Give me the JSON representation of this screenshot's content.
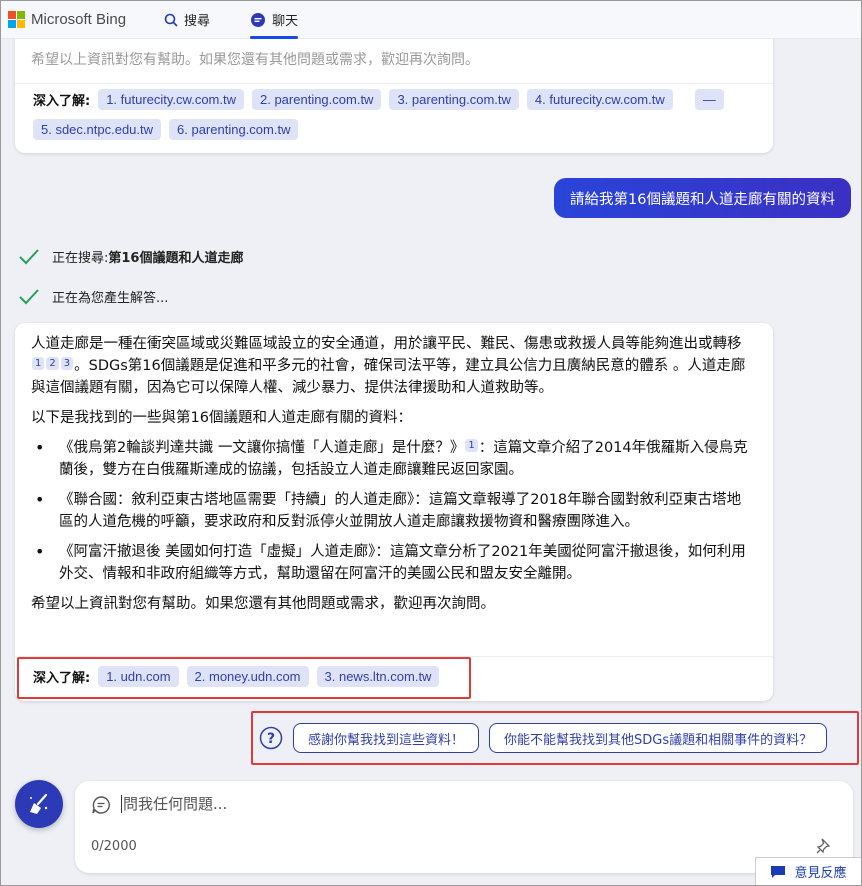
{
  "header": {
    "brand": "Microsoft Bing",
    "tabs": [
      {
        "label": "搜尋",
        "icon": "search-icon"
      },
      {
        "label": "聊天",
        "icon": "chat-icon",
        "active": true
      }
    ],
    "logo_colors": [
      "#f25022",
      "#7fba00",
      "#00a4ef",
      "#ffb900"
    ]
  },
  "previous_answer": {
    "closing_text": "希望以上資訊對您有幫助。如果您還有其他問題或需求，歡迎再次詢問。",
    "learn_more_label": "深入了解:",
    "links": [
      "1. futurecity.cw.com.tw",
      "2. parenting.com.tw",
      "3. parenting.com.tw",
      "4. futurecity.cw.com.tw",
      "5. sdec.ntpc.edu.tw",
      "6. parenting.com.tw"
    ],
    "collapse_label": "—"
  },
  "user_message": "請給我第16個議題和人道走廊有關的資料",
  "status": {
    "searching_prefix": "正在搜尋: ",
    "searching_query": "第16個議題和人道走廊",
    "generating": "正在為您產生解答..."
  },
  "answer": {
    "para1_a": "人道走廊是一種在衝突區域或災難區域設立的安全通道，用於讓平民、難民、傷患或救援人員等能夠進出或轉移",
    "para1_cites": [
      "1",
      "2",
      "3"
    ],
    "para1_b": "。SDGs第16個議題是促進和平多元的社會，確保司法平等，建立具公信力且廣納民意的體系 。人道走廊與這個議題有關，因為它可以保障人權、減少暴力、提供法律援助和人道救助等。",
    "para2": "以下是我找到的一些與第16個議題和人道走廊有關的資料：",
    "items": [
      {
        "title": "《俄烏第2輪談判達共識 一文讓你搞懂「人道走廊」是什麼？》",
        "cite": "1",
        "text": "：這篇文章介紹了2014年俄羅斯入侵烏克蘭後，雙方在白俄羅斯達成的協議，包括設立人道走廊讓難民返回家園。"
      },
      {
        "title": "《聯合國：敘利亞東古塔地區需要「持續」的人道走廊》",
        "cite": "",
        "text": "：這篇文章報導了2018年聯合國對敘利亞東古塔地區的人道危機的呼籲，要求政府和反對派停火並開放人道走廊讓救援物資和醫療團隊進入。"
      },
      {
        "title": "《阿富汗撤退後 美國如何打造「虛擬」人道走廊》",
        "cite": "",
        "text": "：這篇文章分析了2021年美國從阿富汗撤退後，如何利用外交、情報和非政府組織等方式，幫助還留在阿富汗的美國公民和盟友安全離開。"
      }
    ],
    "closing": "希望以上資訊對您有幫助。如果您還有其他問題或需求，歡迎再次詢問。",
    "learn_more_label": "深入了解:",
    "links": [
      "1. udn.com",
      "2. money.udn.com",
      "3. news.ltn.com.tw"
    ]
  },
  "suggestions": [
    "感謝你幫我找到這些資料！",
    "你能不能幫我找到其他SDGs議題和相關事件的資料？"
  ],
  "input": {
    "placeholder": "問我任何問題...",
    "counter": "0/2000"
  },
  "feedback_label": "意見反應",
  "colors": {
    "accent": "#174ae4",
    "chip_bg": "#dfe3f8",
    "chip_text": "#2f3fa8",
    "highlight_box": "#e03a3a",
    "check": "#2aa05a"
  }
}
